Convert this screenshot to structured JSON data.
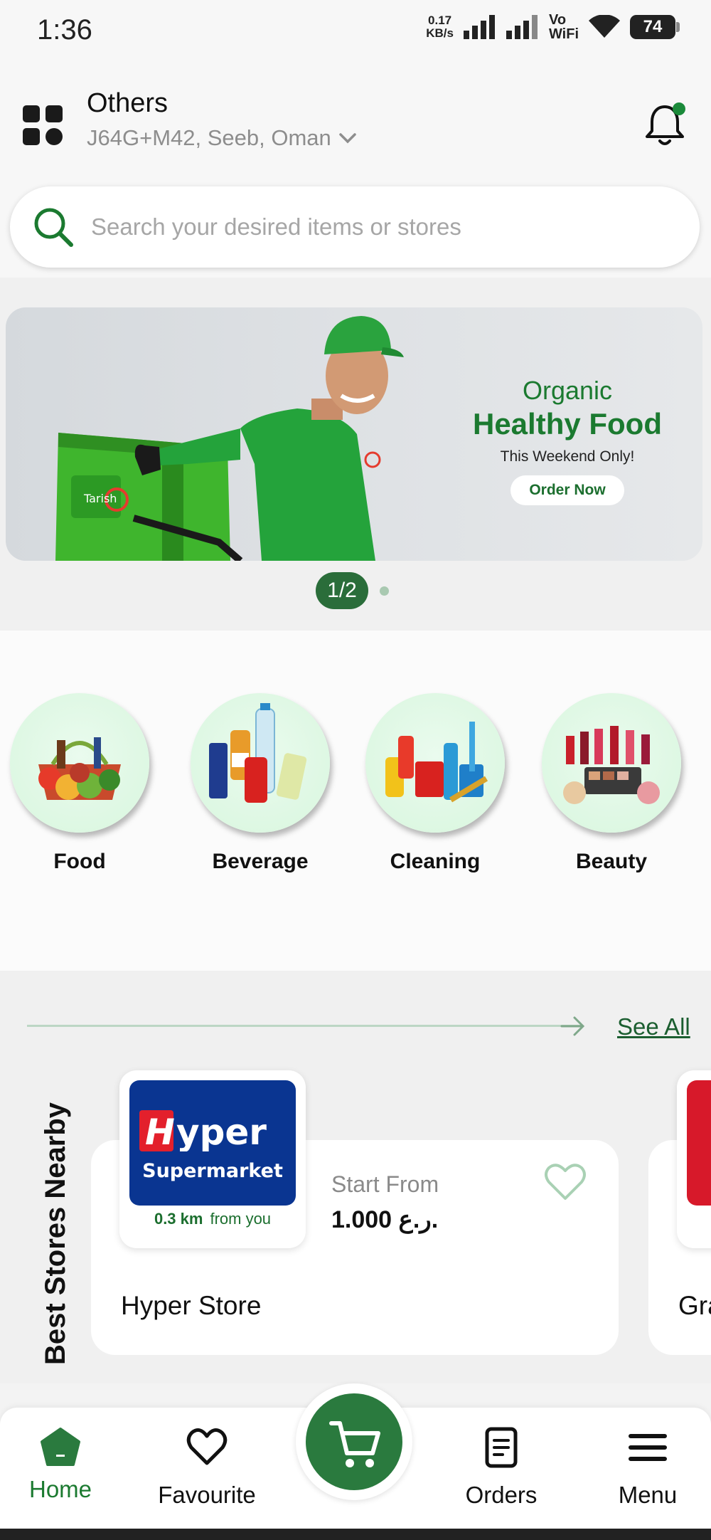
{
  "status_bar": {
    "time": "1:36",
    "net_speed_value": "0.17",
    "net_speed_unit": "KB/s",
    "vowifi_top": "Vo",
    "vowifi_bottom": "WiFi",
    "battery": "74"
  },
  "header": {
    "location_title": "Others",
    "location_address": "J64G+M42, Seeb, Oman",
    "notification_dot_color": "#1b8a3a"
  },
  "search": {
    "placeholder": "Search your desired items or stores"
  },
  "banner": {
    "line1": "Organic",
    "line2": "Healthy Food",
    "line3": "This Weekend Only!",
    "cta": "Order Now",
    "bag_brand": "Tarish",
    "page_indicator": "1/2",
    "total_pages": 2,
    "current_page": 1
  },
  "categories": [
    {
      "label": "Food",
      "icon": "food-basket-icon"
    },
    {
      "label": "Beverage",
      "icon": "beverage-bottles-icon"
    },
    {
      "label": "Cleaning",
      "icon": "cleaning-supplies-icon"
    },
    {
      "label": "Beauty",
      "icon": "cosmetics-icon"
    }
  ],
  "nearby": {
    "section_title": "Best Stores Nearby",
    "see_all": "See All",
    "stores": [
      {
        "name": "Hyper Store",
        "logo_line1": "Hyper",
        "logo_line2": "Supermarket",
        "distance_value": "0.3 km",
        "distance_suffix": "from you",
        "start_from_label": "Start From",
        "price": "1.000 ر.ع.",
        "favourite": false
      },
      {
        "name": "Gra"
      }
    ]
  },
  "bottom_nav": {
    "items": [
      {
        "label": "Home",
        "icon": "home-icon",
        "active": true
      },
      {
        "label": "Favourite",
        "icon": "heart-icon",
        "active": false
      },
      {
        "label": "Orders",
        "icon": "orders-icon",
        "active": false
      },
      {
        "label": "Menu",
        "icon": "menu-icon",
        "active": false
      }
    ],
    "cart_icon": "cart-icon"
  },
  "colors": {
    "brand_green": "#2a7a3e",
    "accent_green": "#1b7a30"
  }
}
